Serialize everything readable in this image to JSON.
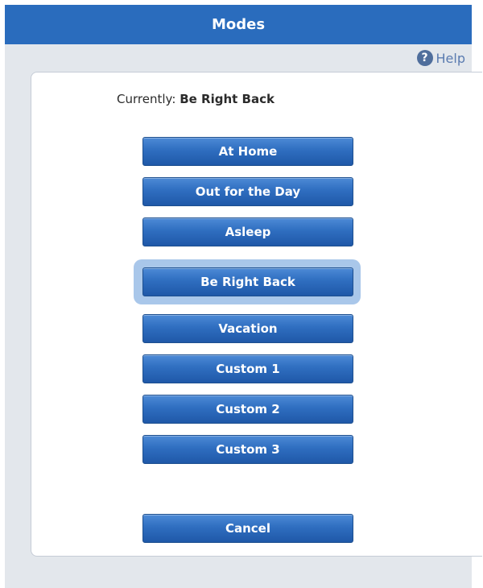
{
  "dialog": {
    "title": "Modes",
    "help_label": "Help",
    "help_icon": "question-circle-icon"
  },
  "status": {
    "label": "Currently:",
    "value": "Be Right Back"
  },
  "modes": [
    "At Home",
    "Out for the Day",
    "Asleep",
    "Be Right Back",
    "Vacation",
    "Custom 1",
    "Custom 2",
    "Custom 3"
  ],
  "selected_mode": "Be Right Back",
  "cancel_label": "Cancel",
  "colors": {
    "title_bar": "#2a6cbd",
    "button": "#2f6ec0",
    "selected_highlight": "#a9c7ea",
    "background": "#e3e7ec"
  }
}
